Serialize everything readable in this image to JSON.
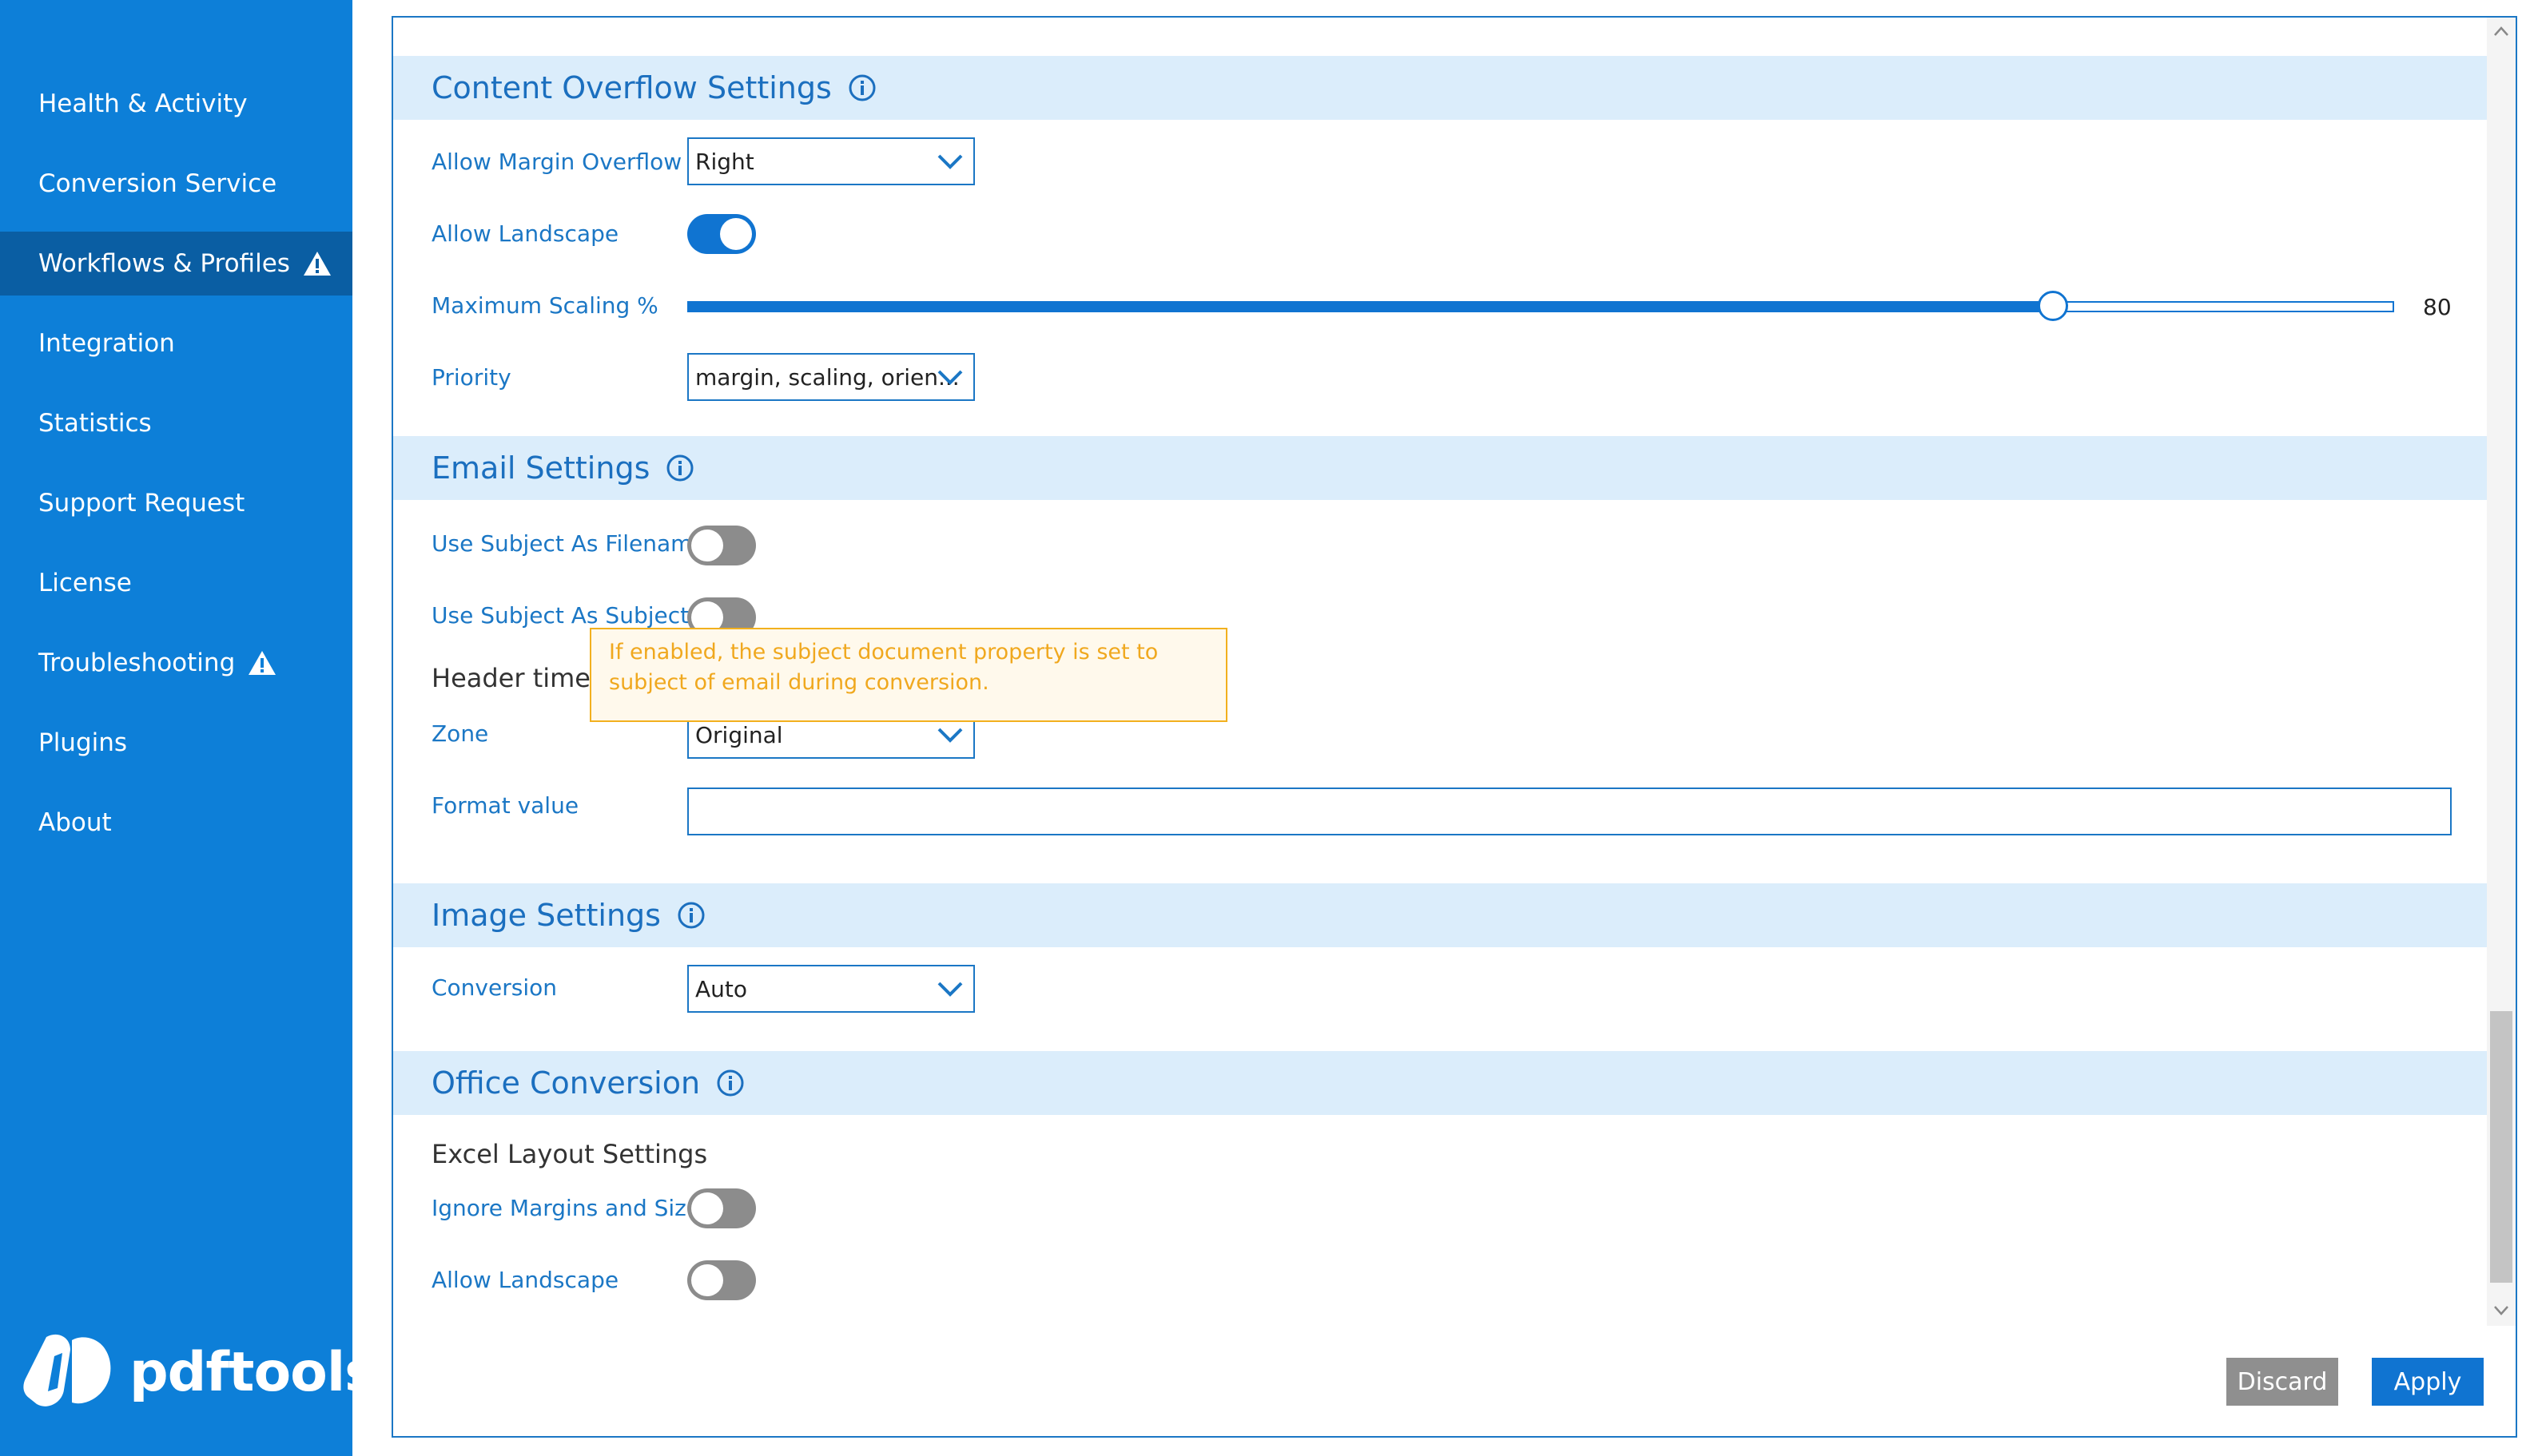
{
  "sidebar": {
    "items": [
      {
        "label": "Health & Activity",
        "warning": false,
        "active": false
      },
      {
        "label": "Conversion Service",
        "warning": false,
        "active": false
      },
      {
        "label": "Workflows & Profiles",
        "warning": true,
        "active": true
      },
      {
        "label": "Integration",
        "warning": false,
        "active": false
      },
      {
        "label": "Statistics",
        "warning": false,
        "active": false
      },
      {
        "label": "Support Request",
        "warning": false,
        "active": false
      },
      {
        "label": "License",
        "warning": false,
        "active": false
      },
      {
        "label": "Troubleshooting",
        "warning": true,
        "active": false
      },
      {
        "label": "Plugins",
        "warning": false,
        "active": false
      },
      {
        "label": "About",
        "warning": false,
        "active": false
      }
    ],
    "logo_text": "pdftools"
  },
  "content_overflow": {
    "title": "Content Overflow Settings",
    "allow_margin_overflow_label": "Allow Margin Overflow",
    "allow_margin_overflow_value": "Right",
    "allow_landscape_label": "Allow Landscape",
    "allow_landscape_on": true,
    "max_scaling_label": "Maximum Scaling %",
    "max_scaling_value": "80",
    "max_scaling_fraction": 0.8,
    "priority_label": "Priority",
    "priority_value": "margin, scaling, orien..."
  },
  "email": {
    "title": "Email Settings",
    "use_subject_filename_label": "Use Subject As Filename",
    "use_subject_filename_on": false,
    "use_subject_subject_label": "Use Subject As Subject...",
    "use_subject_subject_on": false,
    "header_time_label": "Header time f",
    "zone_label": "Zone",
    "zone_value": "Original",
    "format_value_label": "Format value",
    "format_value": ""
  },
  "tooltip": {
    "text": "If enabled, the subject document property is set to subject of email during conversion."
  },
  "image": {
    "title": "Image Settings",
    "conversion_label": "Conversion",
    "conversion_value": "Auto"
  },
  "office": {
    "title": "Office Conversion",
    "excel_layout_label": "Excel Layout Settings",
    "ignore_margins_label": "Ignore Margins and Size",
    "ignore_margins_on": false,
    "allow_landscape_label": "Allow Landscape",
    "allow_landscape_on": false
  },
  "footer": {
    "discard_label": "Discard",
    "apply_label": "Apply"
  },
  "colors": {
    "sidebar_bg": "#0d7fd8",
    "sidebar_active": "#0a5ea3",
    "accent": "#1074d1",
    "section_bg": "#dbedfb",
    "tooltip_text": "#f0a81e"
  }
}
